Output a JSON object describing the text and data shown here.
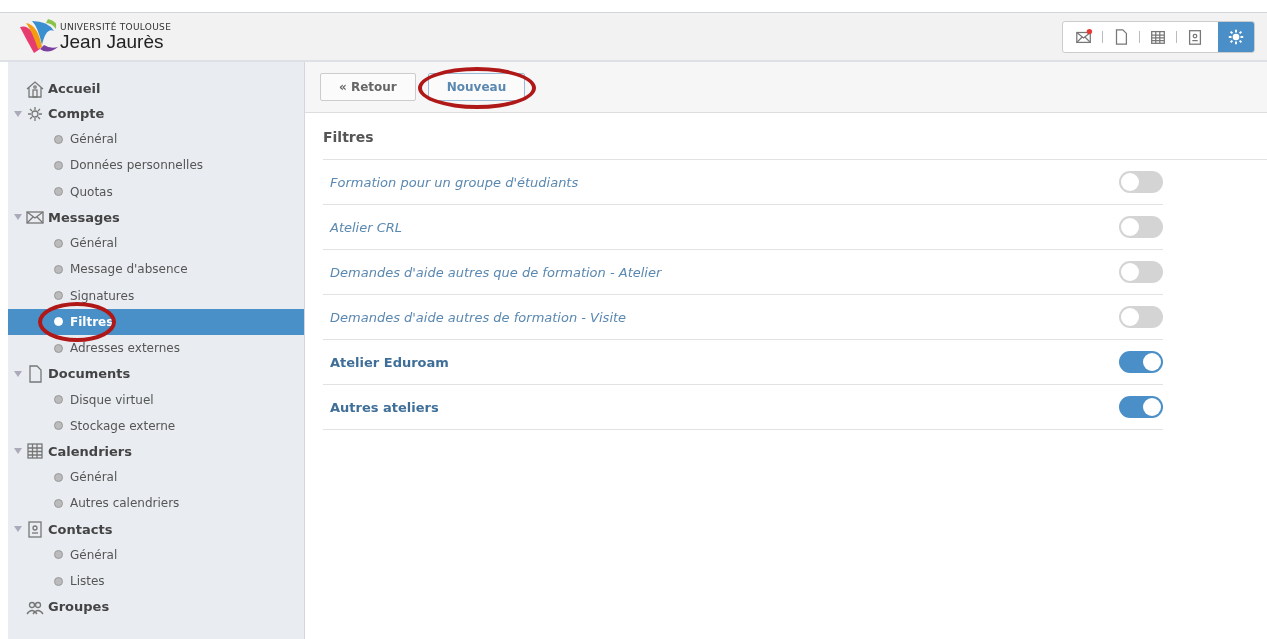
{
  "header": {
    "logo_line1": "UNIVERSITÉ TOULOUSE",
    "logo_line2": "Jean Jaurès",
    "apps": [
      {
        "selected": false,
        "badge": true
      },
      {
        "selected": false,
        "badge": false
      },
      {
        "selected": false,
        "badge": false
      },
      {
        "selected": false,
        "badge": false
      },
      {
        "selected": true,
        "badge": false
      }
    ]
  },
  "sidebar": {
    "sections": [
      {
        "label": "Accueil",
        "selected": false
      },
      {
        "label": "Compte",
        "selected": false,
        "expanded": true,
        "children": [
          {
            "label": "Général",
            "selected": false,
            "circled": false
          },
          {
            "label": "Données personnelles",
            "selected": false,
            "circled": false
          },
          {
            "label": "Quotas",
            "selected": false,
            "circled": false
          }
        ]
      },
      {
        "label": "Messages",
        "selected": false,
        "expanded": true,
        "children": [
          {
            "label": "Général",
            "selected": false,
            "circled": false
          },
          {
            "label": "Message d'absence",
            "selected": false,
            "circled": false
          },
          {
            "label": "Signatures",
            "selected": false,
            "circled": false
          },
          {
            "label": "Filtres",
            "selected": true,
            "circled": true
          },
          {
            "label": "Adresses externes",
            "selected": false,
            "circled": false
          }
        ]
      },
      {
        "label": "Documents",
        "selected": false,
        "expanded": true,
        "children": [
          {
            "label": "Disque virtuel",
            "selected": false,
            "circled": false
          },
          {
            "label": "Stockage externe",
            "selected": false,
            "circled": false
          }
        ]
      },
      {
        "label": "Calendriers",
        "selected": false,
        "expanded": true,
        "children": [
          {
            "label": "Général",
            "selected": false,
            "circled": false
          },
          {
            "label": "Autres calendriers",
            "selected": false,
            "circled": false
          }
        ]
      },
      {
        "label": "Contacts",
        "selected": false,
        "expanded": true,
        "children": [
          {
            "label": "Général",
            "selected": false,
            "circled": false
          },
          {
            "label": "Listes",
            "selected": false,
            "circled": false
          }
        ]
      },
      {
        "label": "Groupes",
        "selected": false
      }
    ]
  },
  "toolbar": {
    "buttons": [
      {
        "label": "« Retour",
        "circled": false
      },
      {
        "label": "Nouveau",
        "circled": true
      }
    ]
  },
  "filters": {
    "title": "Filtres",
    "rows": [
      {
        "name": "Formation pour un groupe d'étudiants",
        "on": false
      },
      {
        "name": "Atelier CRL",
        "on": false
      },
      {
        "name": "Demandes d'aide autres que de formation - Atelier",
        "on": false
      },
      {
        "name": "Demandes d'aide autres de formation - Visite",
        "on": false
      },
      {
        "name": "Atelier Eduroam",
        "on": true
      },
      {
        "name": "Autres ateliers",
        "on": true
      }
    ]
  }
}
